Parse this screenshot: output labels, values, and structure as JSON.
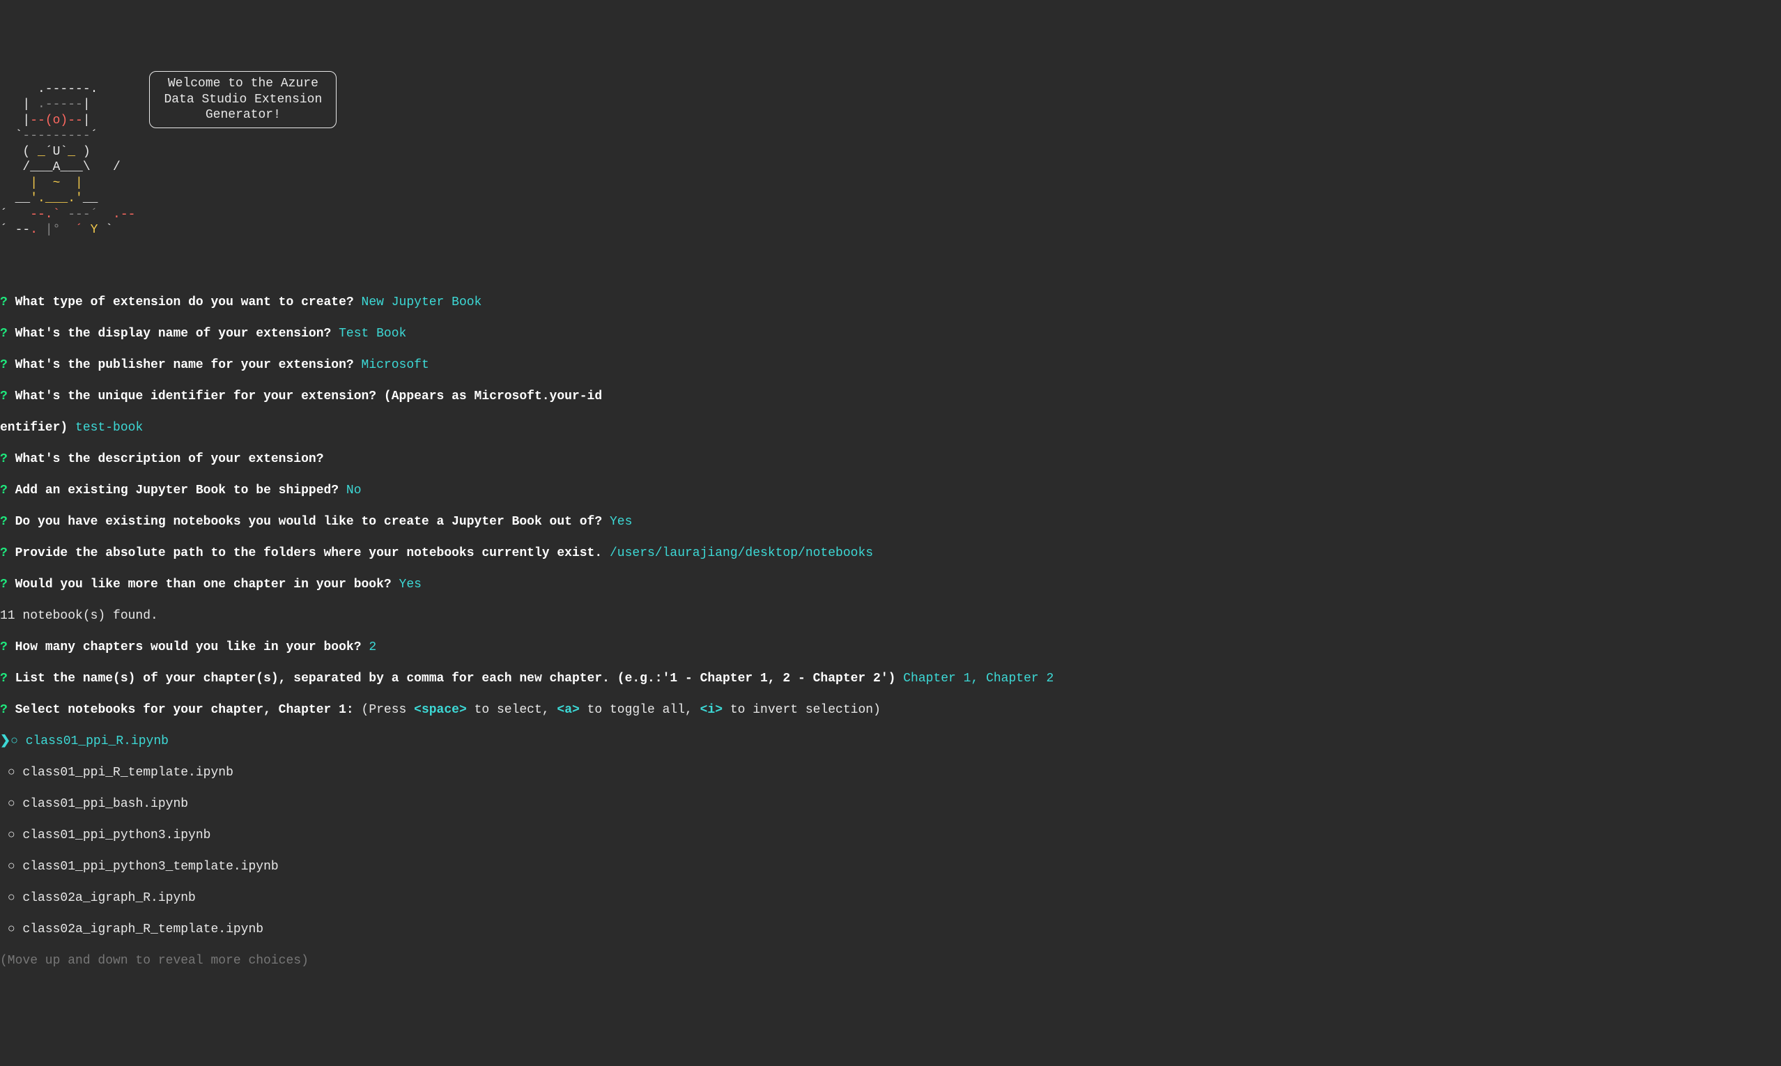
{
  "welcome": {
    "line1": "Welcome to the Azure",
    "line2": "Data Studio Extension",
    "line3": "Generator!"
  },
  "ascii": {
    "l1": "     .------.",
    "l2a": "   |",
    "l2b": " .-----",
    "l2c": "|",
    "l3a": "   |",
    "l3b": "--(o)--",
    "l3c": "|",
    "l4a": "  `",
    "l4b": "---------",
    "l4c": "´",
    "l5a": "   ( ",
    "l5b": "_",
    "l5c": "´U`",
    "l5d": "_",
    "l5e": " )",
    "l6": "   /___A___\\   /",
    "l7a": "    ",
    "l7b": "|  ~  |",
    "l8a": "  __",
    "l8b": "'.___.'",
    "l8c": "__",
    "l9a": "´  ",
    "l9b": " --.`",
    "l9c": " ---´",
    "l9d": "  .--",
    "l10a": "´ --",
    "l10b": ".",
    "l10c": " |°",
    "l10d": "  ´",
    "l10e": " Y",
    "l10f": " `"
  },
  "prompts": [
    {
      "q": "What type of extension do you want to create?",
      "a": "New Jupyter Book"
    },
    {
      "q": "What's the display name of your extension?",
      "a": "Test Book"
    },
    {
      "q": "What's the publisher name for your extension?",
      "a": "Microsoft"
    },
    {
      "q_part1": "What's the unique identifier for your extension? (Appears as Microsoft.your-id",
      "q_cont": "entifier)",
      "a": "test-book",
      "multiline": true
    },
    {
      "q": "What's the description of your extension?",
      "a": ""
    },
    {
      "q": "Add an existing Jupyter Book to be shipped?",
      "a": "No"
    },
    {
      "q": "Do you have existing notebooks you would like to create a Jupyter Book out of?",
      "a": "Yes"
    },
    {
      "q": "Provide the absolute path to the folders where your notebooks currently exist.",
      "a": "/users/laurajiang/desktop/notebooks"
    },
    {
      "q": "Would you like more than one chapter in your book?",
      "a": "Yes"
    }
  ],
  "found": "11 notebook(s) found.",
  "prompts2": [
    {
      "q": "How many chapters would you like in your book?",
      "a": "2"
    },
    {
      "q": "List the name(s) of your chapter(s), separated by a comma for each new chapter. (e.g.:'1 - Chapter 1, 2 - Chapter 2')",
      "a": "Chapter 1, Chapter 2"
    }
  ],
  "selectPrompt": {
    "q": "Select notebooks for your chapter, Chapter 1:",
    "instr_pre": " (Press ",
    "key1": "<space>",
    "instr_mid1": " to select, ",
    "key2": "<a>",
    "instr_mid2": " to toggle all, ",
    "key3": "<i>",
    "instr_post": " to invert selection)"
  },
  "options": [
    {
      "label": "class01_ppi_R.ipynb",
      "current": true
    },
    {
      "label": "class01_ppi_R_template.ipynb",
      "current": false
    },
    {
      "label": "class01_ppi_bash.ipynb",
      "current": false
    },
    {
      "label": "class01_ppi_python3.ipynb",
      "current": false
    },
    {
      "label": "class01_ppi_python3_template.ipynb",
      "current": false
    },
    {
      "label": "class02a_igraph_R.ipynb",
      "current": false
    },
    {
      "label": "class02a_igraph_R_template.ipynb",
      "current": false
    }
  ],
  "footer": "(Move up and down to reveal more choices)"
}
